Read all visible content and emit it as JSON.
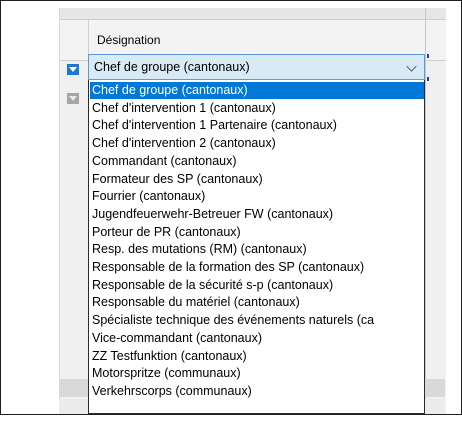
{
  "grid": {
    "column_header": "Désignation",
    "current_value": "Chef de groupe (cantonaux)"
  },
  "dropdown": {
    "selected_index": 0,
    "options": [
      "Chef de groupe (cantonaux)",
      "Chef d'intervention 1 (cantonaux)",
      "Chef d'intervention 1 Partenaire (cantonaux)",
      "Chef d'intervention 2 (cantonaux)",
      "Commandant (cantonaux)",
      "Formateur des SP (cantonaux)",
      "Fourrier (cantonaux)",
      "Jugendfeuerwehr-Betreuer FW (cantonaux)",
      "Porteur de PR (cantonaux)",
      "Resp. des mutations (RM) (cantonaux)",
      "Responsable de la formation des SP (cantonaux)",
      "Responsable de la sécurité s-p (cantonaux)",
      "Responsable du matériel (cantonaux)",
      "Spécialiste technique des événements naturels (ca",
      "Vice-commandant (cantonaux)",
      "ZZ Testfunktion (cantonaux)",
      "Motorspritze (communaux)",
      "Verkehrscorps (communaux)"
    ]
  },
  "colors": {
    "selection": "#0078d7",
    "combo_background": "#d9eaf7",
    "row_indicator": "#1e77d1"
  },
  "icons": {
    "combo_arrow": "chevron-down-icon",
    "row_indicator": "caret-down-icon"
  }
}
